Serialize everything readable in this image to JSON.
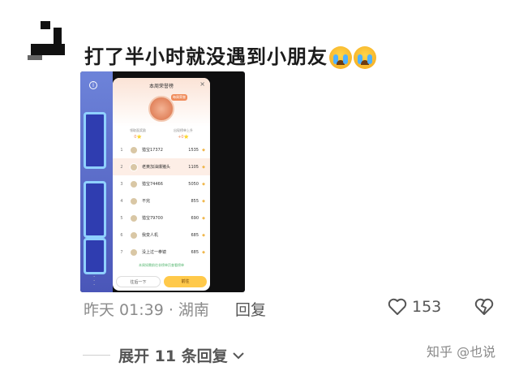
{
  "comment": {
    "text": "打了半小时就没遇到小朋友",
    "emojis": [
      "loudly-crying-face",
      "loudly-crying-face"
    ]
  },
  "screenshot": {
    "panel_title": "本周荣誉榜",
    "badge_tag": "每周荣誉",
    "stats": [
      {
        "label": "领取面奖励",
        "value": "0⭐"
      },
      {
        "label": "出现榜单上升",
        "value": "+0⭐"
      }
    ],
    "rows": [
      {
        "rank": "1",
        "name": "猎宝17372",
        "score": "1535",
        "me": false
      },
      {
        "rank": "2",
        "name": "老黄加油爆猪头",
        "score": "1105",
        "me": true
      },
      {
        "rank": "3",
        "name": "猎宝74466",
        "score": "5050",
        "me": false
      },
      {
        "rank": "4",
        "name": "不完",
        "score": "855",
        "me": false
      },
      {
        "rank": "5",
        "name": "猎宝79700",
        "score": "690",
        "me": false
      },
      {
        "rank": "6",
        "name": "我变人机",
        "score": "685",
        "me": false
      },
      {
        "rank": "7",
        "name": "没上过一拳镜",
        "score": "685",
        "me": false
      }
    ],
    "foot_note": "本周如需前往非榜单页查看榜单",
    "button_left": "往后一下",
    "button_right": "前往"
  },
  "meta": {
    "time_location": "昨天 01:39 · 湖南",
    "reply_label": "回复",
    "like_count": "153"
  },
  "expand": {
    "label": "展开 11 条回复"
  },
  "watermark": "知乎 @也说",
  "colors": {
    "meta_gray": "#8b8b8b",
    "accent_orange": "#f08c5b",
    "button_yellow": "#ffc94a"
  }
}
